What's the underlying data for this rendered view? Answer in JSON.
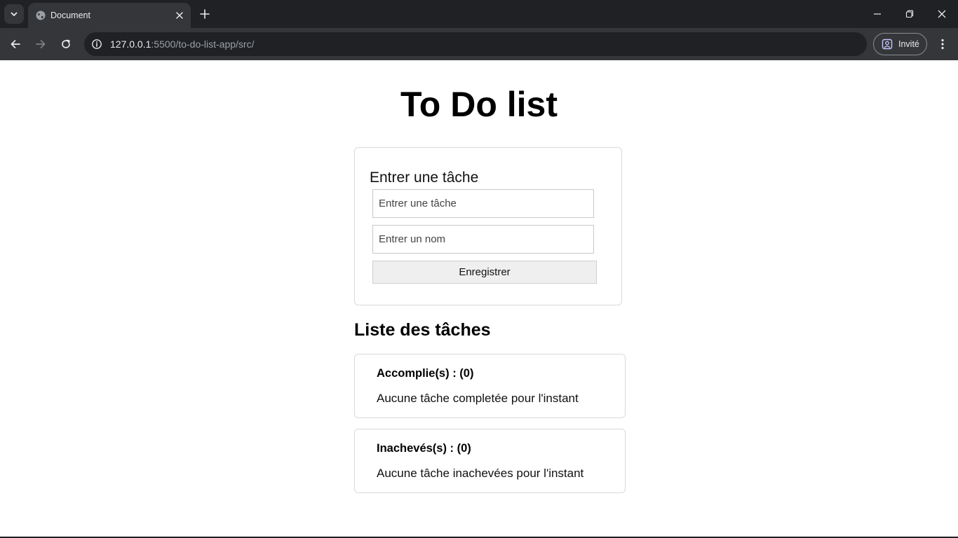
{
  "browser": {
    "tab": {
      "title": "Document"
    },
    "address": {
      "host": "127.0.0.1",
      "path": ":5500/to-do-list-app/src/"
    },
    "profile": {
      "label": "Invité"
    }
  },
  "page": {
    "title": "To Do list",
    "form": {
      "heading": "Entrer une tâche",
      "task_input": {
        "placeholder": "Entrer une tâche",
        "value": ""
      },
      "name_input": {
        "placeholder": "Entrer un nom",
        "value": ""
      },
      "save_label": "Enregistrer"
    },
    "list": {
      "heading": "Liste des tâches",
      "completed": {
        "title": "Accomplie(s) : (0)",
        "empty_text": "Aucune tâche completée pour l'instant"
      },
      "pending": {
        "title": "Inachevés(s) : (0)",
        "empty_text": "Aucune tâche inachevées pour l'instant"
      }
    }
  },
  "icons": {
    "tab_search": "chevron-down-icon",
    "favicon": "globe-icon",
    "tab_close": "close-icon",
    "new_tab": "plus-icon",
    "back": "arrow-left-icon",
    "forward": "arrow-right-icon",
    "reload": "reload-icon",
    "site_info": "info-icon",
    "profile": "profile-icon",
    "menu": "kebab-menu-icon",
    "window": [
      "minimize-icon",
      "restore-icon",
      "close-window-icon"
    ]
  },
  "colors": {
    "tabbar_bg": "#202124",
    "toolbar_bg": "#35363a",
    "omnibox_bg": "#202124",
    "page_bg": "#ffffff",
    "card_border": "#d8d8d8",
    "button_bg": "#efefef"
  }
}
